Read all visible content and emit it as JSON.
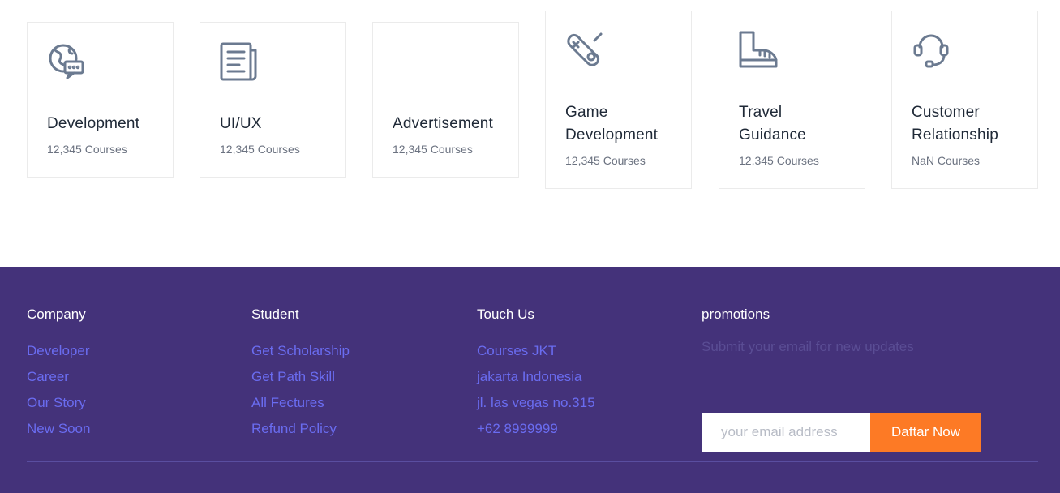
{
  "categories": [
    {
      "title": "Development",
      "count": "12,345 Courses",
      "icon": "globe-chat-icon"
    },
    {
      "title": "UI/UX",
      "count": "12,345 Courses",
      "icon": "newspaper-icon"
    },
    {
      "title": "Advertisement",
      "count": "12,345 Courses",
      "icon": "none"
    },
    {
      "title_line1": "Game",
      "title_line2": "Development",
      "count": "12,345 Courses",
      "icon": "gamepad-icon"
    },
    {
      "title_line1": "Travel",
      "title_line2": "Guidance",
      "count": "12,345 Courses",
      "icon": "boot-icon"
    },
    {
      "title_line1": "Customer",
      "title_line2": "Relationship",
      "count": "NaN Courses",
      "icon": "headset-icon"
    }
  ],
  "footer": {
    "company": {
      "title": "Company",
      "links": [
        "Developer",
        "Career",
        "Our Story",
        "New Soon"
      ]
    },
    "student": {
      "title": "Student",
      "links": [
        "Get Scholarship",
        "Get Path Skill",
        "All Fectures",
        "Refund Policy"
      ]
    },
    "touch": {
      "title": "Touch Us",
      "links": [
        "Courses JKT",
        "jakarta Indonesia",
        "jl. las vegas no.315",
        "+62 8999999"
      ]
    },
    "promotions": {
      "title": "promotions",
      "subtitle": "Submit your email for new updates",
      "email_placeholder": "your email address",
      "button_label": "Daftar Now"
    }
  },
  "colors": {
    "footer_bg": "#44327a",
    "link": "#6a6cf0",
    "accent_button": "#fd7a25",
    "icon_stroke": "#6b7a90"
  }
}
